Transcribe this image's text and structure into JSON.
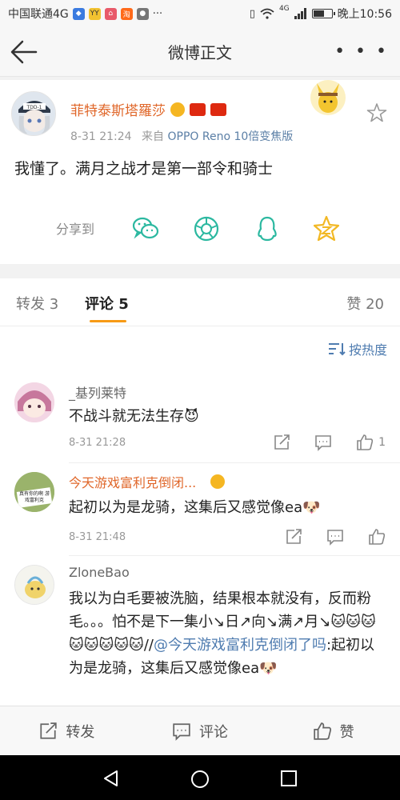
{
  "status_bar": {
    "carrier": "中国联通4G",
    "network": "4G",
    "time": "晚上10:56",
    "battery_level": 0.55
  },
  "nav": {
    "title": "微博正文",
    "more": "• • •"
  },
  "post": {
    "username": "菲特泰斯塔羅莎",
    "time": "8-31 21:24",
    "source_prefix": "来自",
    "source": "OPPO Reno 10倍变焦版",
    "text": "我懂了。满月之战才是第一部令和骑士",
    "share_label": "分享到"
  },
  "tabs": {
    "repost": "转发 3",
    "comment": "评论 5",
    "like": "赞 20"
  },
  "sort_label": "按热度",
  "comments": [
    {
      "name": "_基列莱特",
      "text": "不战斗就无法生存",
      "time": "8-31 21:28",
      "likes": "1"
    },
    {
      "name": "今天游戏富利克倒闭...",
      "text": "起初以为是龙骑，这集后又感觉像ea",
      "time": "8-31 21:48",
      "avatar_text": "真有你的啊 游戏富利克"
    },
    {
      "name": "ZloneBao",
      "text_part1": "我以为白毛要被洗脑，结果根本就没有，反而粉毛。。。怕不是下一集小↘日↗向↘满↗月↘",
      "text_sep": "//",
      "mention": "@今天游戏富利克倒闭了吗",
      "text_part2": ":起初以为是龙骑，这集后又感觉像ea"
    }
  ],
  "action_bar": {
    "repost": "转发",
    "comment": "评论",
    "like": "赞"
  },
  "colors": {
    "orange_name": "#e0672a",
    "link_blue": "#4f7cb0",
    "tab_underline": "#f79a15",
    "share_green": "#2bb8a0"
  }
}
